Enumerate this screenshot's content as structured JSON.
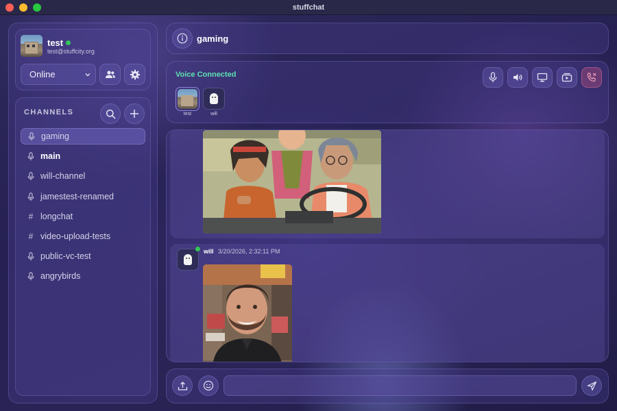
{
  "window": {
    "title": "stuffchat"
  },
  "user": {
    "name": "test",
    "email": "test@stuffcity.org",
    "status_color": "#34c759",
    "status_select": "Online"
  },
  "sidebar": {
    "channels_heading": "CHANNELS",
    "channels": [
      {
        "label": "gaming",
        "icon": "microphone-icon",
        "active": true
      },
      {
        "label": "main",
        "icon": "microphone-icon",
        "bold": true
      },
      {
        "label": "will-channel",
        "icon": "microphone-icon"
      },
      {
        "label": "jamestest-renamed",
        "icon": "microphone-icon"
      },
      {
        "label": "longchat",
        "icon": "hash-icon",
        "glyph": "#"
      },
      {
        "label": "video-upload-tests",
        "icon": "hash-icon",
        "glyph": "#"
      },
      {
        "label": "public-vc-test",
        "icon": "microphone-icon"
      },
      {
        "label": "angrybirds",
        "icon": "microphone-icon"
      }
    ]
  },
  "header": {
    "channel_name": "gaming"
  },
  "voice": {
    "status": "Voice Connected",
    "status_color": "#5fe0b0",
    "participants": [
      {
        "name": "test",
        "avatar": "photo"
      },
      {
        "name": "will",
        "avatar": "ghost"
      }
    ],
    "hangup_color": "#e0607a"
  },
  "messages": [
    {
      "author": "will",
      "timestamp": "3/20/2026, 2:32:11 PM",
      "attachment": "portrait-photo"
    }
  ],
  "composer": {
    "placeholder": ""
  },
  "accent": "#6b5fc4"
}
